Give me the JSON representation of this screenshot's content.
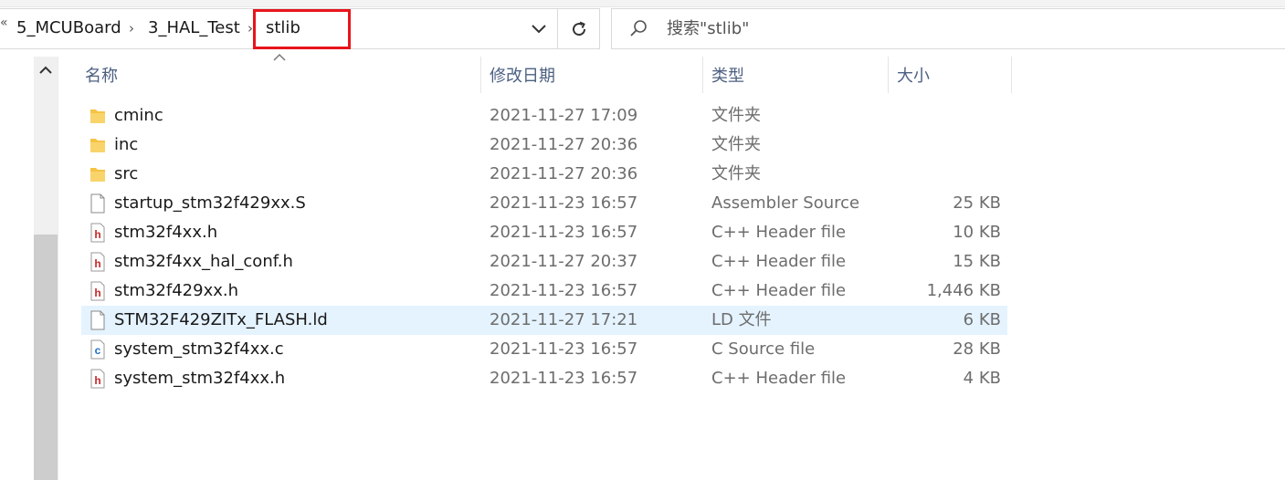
{
  "address_bar": {
    "overflow": "«",
    "crumbs": [
      "5_MCUBoard",
      "3_HAL_Test",
      "stlib"
    ],
    "separator": "›"
  },
  "search": {
    "placeholder": "搜索\"stlib\""
  },
  "columns": {
    "name": "名称",
    "modified": "修改日期",
    "type": "类型",
    "size": "大小"
  },
  "files": [
    {
      "name": "cminc",
      "modified": "2021-11-27 17:09",
      "type": "文件夹",
      "size": "",
      "icon": "folder-icon"
    },
    {
      "name": "inc",
      "modified": "2021-11-27 20:36",
      "type": "文件夹",
      "size": "",
      "icon": "folder-icon"
    },
    {
      "name": "src",
      "modified": "2021-11-27 20:36",
      "type": "文件夹",
      "size": "",
      "icon": "folder-icon"
    },
    {
      "name": "startup_stm32f429xx.S",
      "modified": "2021-11-23 16:57",
      "type": "Assembler Source",
      "size": "25 KB",
      "icon": "file-icon"
    },
    {
      "name": "stm32f4xx.h",
      "modified": "2021-11-23 16:57",
      "type": "C++ Header file",
      "size": "10 KB",
      "icon": "header-file-icon"
    },
    {
      "name": "stm32f4xx_hal_conf.h",
      "modified": "2021-11-27 20:37",
      "type": "C++ Header file",
      "size": "15 KB",
      "icon": "header-file-icon"
    },
    {
      "name": "stm32f429xx.h",
      "modified": "2021-11-23 16:57",
      "type": "C++ Header file",
      "size": "1,446 KB",
      "icon": "header-file-icon"
    },
    {
      "name": "STM32F429ZITx_FLASH.ld",
      "modified": "2021-11-27 17:21",
      "type": "LD 文件",
      "size": "6 KB",
      "icon": "file-icon",
      "selected": true
    },
    {
      "name": "system_stm32f4xx.c",
      "modified": "2021-11-23 16:57",
      "type": "C Source file",
      "size": "28 KB",
      "icon": "c-source-file-icon"
    },
    {
      "name": "system_stm32f4xx.h",
      "modified": "2021-11-23 16:57",
      "type": "C++ Header file",
      "size": "4 KB",
      "icon": "header-file-icon"
    }
  ],
  "colors": {
    "highlight": "#e8141b",
    "selection": "#e5f3ff",
    "folder": "#f6c344",
    "header_icon": "#c62828",
    "c_icon": "#1e6fc7"
  }
}
